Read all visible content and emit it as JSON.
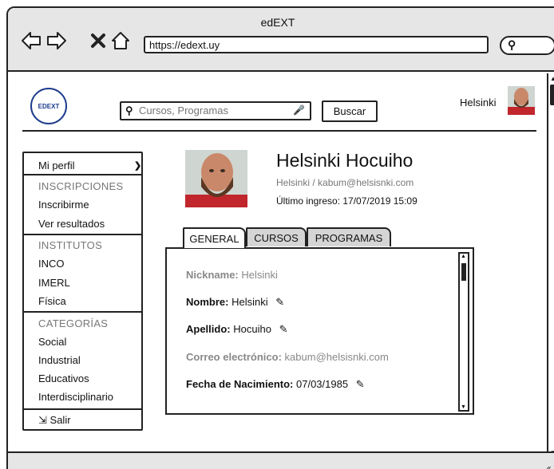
{
  "window": {
    "title": "edEXT"
  },
  "browser": {
    "url": "https://edext.uy"
  },
  "header": {
    "logo_text": "EDEXT",
    "search_placeholder": "Cursos, Programas",
    "search_button": "Buscar",
    "user_name": "Helsinki"
  },
  "sidebar": {
    "profile": "Mi perfil",
    "inscripciones_header": "INSCRIPCIONES",
    "inscribirme": "Inscribirme",
    "ver_resultados": "Ver resultados",
    "institutos_header": "INSTITUTOS",
    "inco": "INCO",
    "imerl": "IMERL",
    "fisica": "Física",
    "categorias_header": "CATEGORÍAS",
    "social": "Social",
    "industrial": "Industrial",
    "educativos": "Educativos",
    "interdisciplinario": "Interdisciplinario",
    "salir": "Salir"
  },
  "profile": {
    "full_name": "Helsinki Hocuiho",
    "subtitle": "Helsinki / kabum@helsisnki.com",
    "last_login": "Último ingreso: 17/07/2019 15:09"
  },
  "tabs": [
    "GENERAL",
    "CURSOS",
    "PROGRAMAS"
  ],
  "fields": {
    "nickname_label": "Nickname:",
    "nickname_value": "Helsinki",
    "nombre_label": "Nombre:",
    "nombre_value": "Helsinki",
    "apellido_label": "Apellido:",
    "apellido_value": "Hocuiho",
    "correo_label": "Correo electrónico:",
    "correo_value": "kabum@helsisnki.com",
    "fecha_label": "Fecha de Nacimiento:",
    "fecha_value": "07/03/1985"
  },
  "icons": {
    "back": "arrow-left-icon",
    "forward": "arrow-right-icon",
    "close": "close-icon",
    "home": "home-icon",
    "search": "search-icon",
    "mic": "microphone-icon",
    "edit": "edit-icon",
    "logout": "sign-out-icon"
  }
}
